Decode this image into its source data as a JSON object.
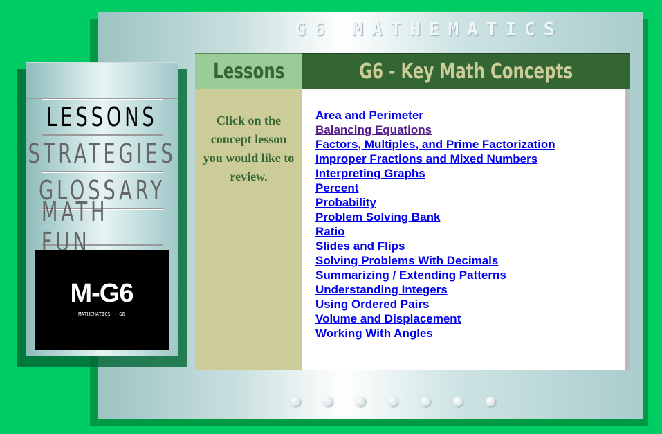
{
  "site_title": "G6 MATHEMATICS",
  "nav": {
    "items": [
      {
        "label": "LESSONS",
        "active": true
      },
      {
        "label": "STRATEGIES",
        "active": false
      },
      {
        "label": "GLOSSARY",
        "active": false
      },
      {
        "label": "MATH FUN",
        "active": false
      }
    ],
    "logo": {
      "title": "M-G6",
      "subtitle": "MATHEMATICS - G6"
    }
  },
  "header": {
    "section": "Lessons",
    "title": "G6 - Key Math Concepts"
  },
  "instructions": "Click on the concept lesson you would like to review.",
  "lessons": [
    {
      "label": "Area and Perimeter",
      "visited": false
    },
    {
      "label": "Balancing Equations",
      "visited": true
    },
    {
      "label": "Factors, Multiples, and Prime Factorization",
      "visited": false
    },
    {
      "label": "Improper Fractions and Mixed Numbers",
      "visited": false
    },
    {
      "label": "Interpreting Graphs",
      "visited": false
    },
    {
      "label": "Percent",
      "visited": false
    },
    {
      "label": "Probability",
      "visited": false
    },
    {
      "label": "Problem Solving Bank",
      "visited": false
    },
    {
      "label": "Ratio",
      "visited": false
    },
    {
      "label": "Slides and Flips",
      "visited": false
    },
    {
      "label": "Solving Problems With Decimals",
      "visited": false
    },
    {
      "label": "Summarizing / Extending Patterns",
      "visited": false
    },
    {
      "label": "Understanding Integers",
      "visited": false
    },
    {
      "label": "Using Ordered Pairs",
      "visited": false
    },
    {
      "label": "Volume and Displacement",
      "visited": false
    },
    {
      "label": "Working With Angles",
      "visited": false
    }
  ],
  "colors": {
    "background": "#00cc66",
    "header_dark": "#336633",
    "header_light": "#99cc99",
    "sidebar": "#cccc99",
    "link": "#0000ee",
    "visited_link": "#551a8b"
  }
}
